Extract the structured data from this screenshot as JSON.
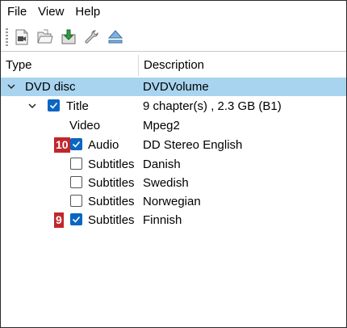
{
  "menu": {
    "items": [
      "File",
      "View",
      "Help"
    ]
  },
  "toolbar": {
    "buttons": [
      {
        "icon": "video-file-icon"
      },
      {
        "icon": "open-folder-icon"
      },
      {
        "icon": "download-icon"
      },
      {
        "icon": "wrench-icon"
      },
      {
        "icon": "eject-icon"
      }
    ]
  },
  "tree": {
    "columns": {
      "type": "Type",
      "description": "Description"
    },
    "rows": [
      {
        "type": "DVD disc",
        "description": "DVDVolume",
        "level": 0,
        "expanded": true,
        "selected": true
      },
      {
        "type": "Title",
        "description": "9 chapter(s) , 2.3 GB (B1)",
        "level": 1,
        "expanded": true,
        "checked": true
      },
      {
        "type": "Video",
        "description": "Mpeg2",
        "level": 2
      },
      {
        "type": "Audio",
        "description": "DD Stereo English",
        "level": 2,
        "checked": true,
        "badge": "10"
      },
      {
        "type": "Subtitles",
        "description": "Danish",
        "level": 2,
        "checked": false
      },
      {
        "type": "Subtitles",
        "description": "Swedish",
        "level": 2,
        "checked": false
      },
      {
        "type": "Subtitles",
        "description": "Norwegian",
        "level": 2,
        "checked": false
      },
      {
        "type": "Subtitles",
        "description": "Finnish",
        "level": 2,
        "checked": true,
        "badge": "9"
      }
    ]
  },
  "colors": {
    "selection": "#a9d4ef",
    "checkbox_checked": "#0a66c2",
    "badge": "#c0272d"
  }
}
